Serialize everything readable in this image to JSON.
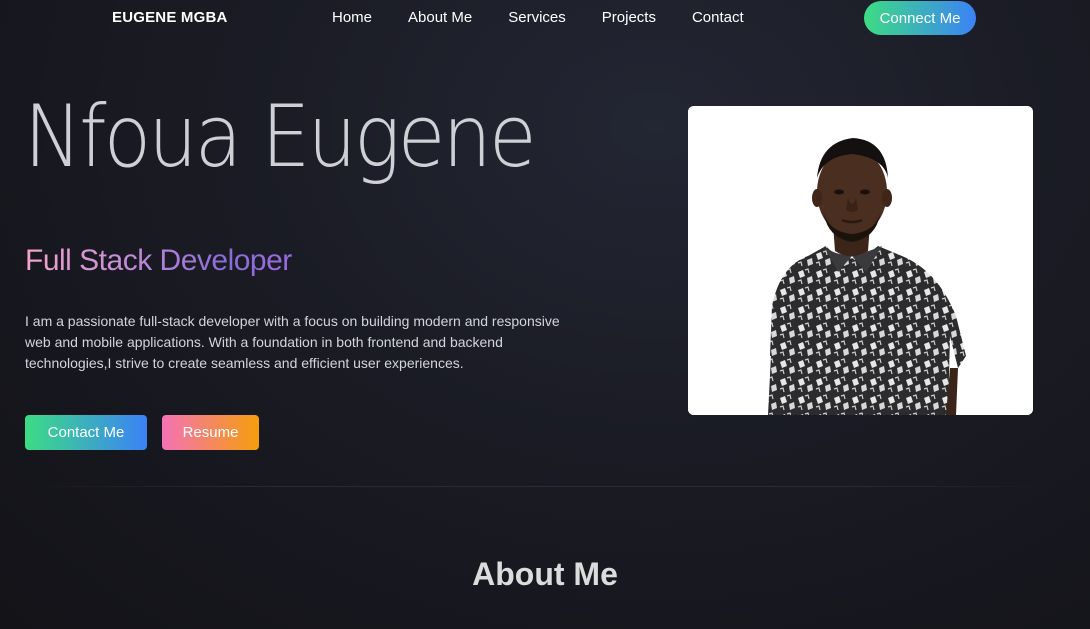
{
  "nav": {
    "brand": "EUGENE MGBA",
    "links": [
      "Home",
      "About Me",
      "Services",
      "Projects",
      "Contact"
    ],
    "cta": "Connect Me"
  },
  "hero": {
    "name": "Nfoua Eugene",
    "role": "Full Stack Developer",
    "bio": "I am a passionate full-stack developer with a focus on building modern and responsive web and mobile applications. With a foundation in both frontend and backend technologies,I strive to create seamless and efficient user experiences.",
    "buttons": {
      "contact": "Contact Me",
      "resume": "Resume"
    }
  },
  "about": {
    "heading": "About Me"
  },
  "colors": {
    "background": "#1a1b24",
    "cta_gradient": [
      "#3ddc84",
      "#3b82f6"
    ],
    "resume_gradient": [
      "#f472b6",
      "#f59e0b"
    ],
    "role_gradient": [
      "#f5a3c7",
      "#9b6be0"
    ]
  }
}
